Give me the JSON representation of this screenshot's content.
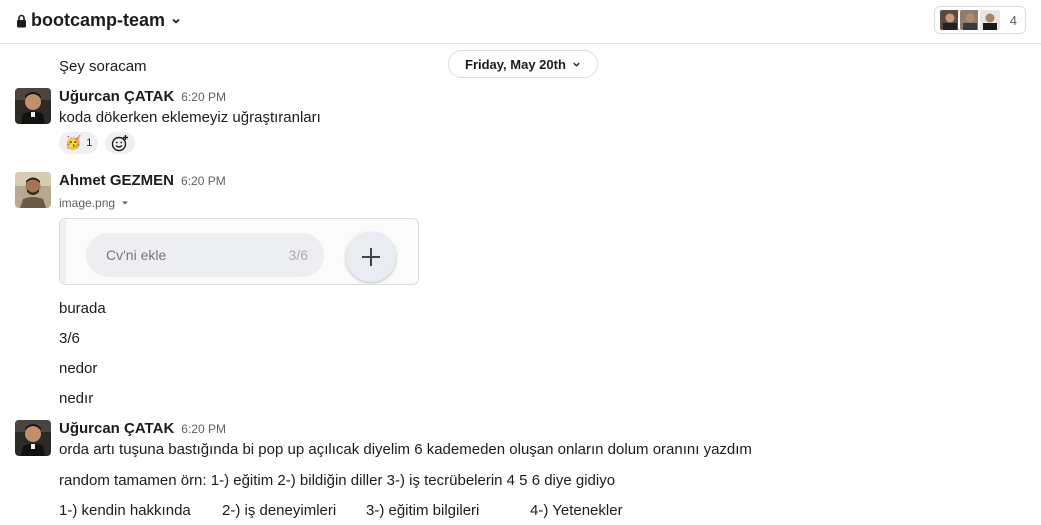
{
  "header": {
    "channel_name": "bootcamp-team",
    "member_count": "4"
  },
  "previous_message": "Şey soracam",
  "date_divider": "Friday, May 20th",
  "messages": [
    {
      "author": "Uğurcan ÇATAK",
      "time": "6:20 PM",
      "text": "koda dökerken eklemeyiz uğraştıranları",
      "reaction": {
        "emoji": "🥳",
        "count": "1"
      }
    },
    {
      "author": "Ahmet GEZMEN",
      "time": "6:20 PM",
      "file": {
        "name": "image.png",
        "preview_placeholder": "Cv'ni ekle",
        "preview_count": "3/6"
      },
      "lines": [
        "burada",
        "3/6",
        "nedor",
        "nedır"
      ]
    },
    {
      "author": "Uğurcan ÇATAK",
      "time": "6:20 PM",
      "text": "orda artı tuşuna bastığında bi pop up açılıcak diyelim 6 kademeden oluşan onların dolum oranını yazdım",
      "lines": [
        "random tamamen örn: 1-) eğitim 2-) bildiğin diller 3-) iş tecrübelerin 4 5 6 diye gidiyo"
      ],
      "tabs": [
        "1-) kendin hakkında",
        "2-) iş deneyimleri",
        "3-) eğitim bilgileri",
        "4-) Yetenekler"
      ]
    }
  ],
  "colors": {
    "text": "#1d1c1d",
    "muted": "#616061",
    "border": "#dddddd"
  }
}
